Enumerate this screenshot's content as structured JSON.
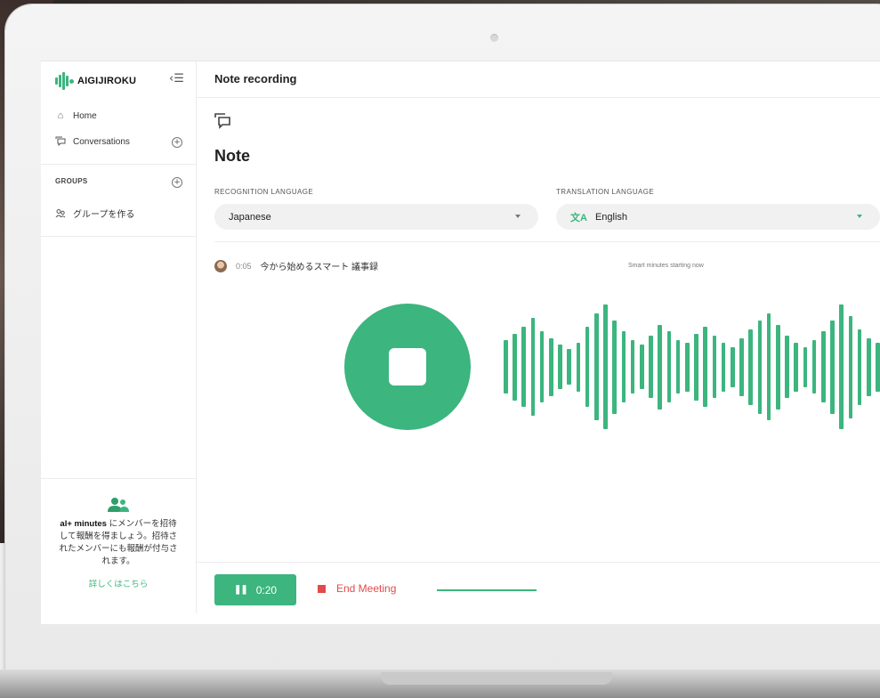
{
  "app": {
    "brand": "AIGIJIROKU",
    "accent_color": "#3cb57e",
    "danger_color": "#e24b4b"
  },
  "sidebar": {
    "collapse_icon": "collapse-menu-icon",
    "items": [
      {
        "label": "Home",
        "icon": "home-icon"
      },
      {
        "label": "Conversations",
        "icon": "chat-icon"
      }
    ],
    "groups_label": "GROUPS",
    "group_item": {
      "label": "グループを作る",
      "icon": "people-icon"
    },
    "promo": {
      "icon": "users-icon",
      "bold": "al+ minutes",
      "text": " にメンバーを招待して報酬を得ましょう。招待されたメンバーにも報酬が付与されます。",
      "link": "詳しくはこちら"
    }
  },
  "header": {
    "title": "Note recording"
  },
  "note": {
    "icon": "note-chat-icon",
    "title": "Note",
    "recognition": {
      "label": "RECOGNITION LANGUAGE",
      "value": "Japanese"
    },
    "translation": {
      "label": "TRANSLATION LANGUAGE",
      "value": "English",
      "icon": "translate-icon"
    }
  },
  "transcript": [
    {
      "time": "0:05",
      "text": "今から始めるスマート 議事録",
      "translation": "Smart minutes starting now"
    }
  ],
  "recorder": {
    "stop_icon": "stop-icon"
  },
  "controls": {
    "timer": "0:20",
    "pause_icon": "pause-icon",
    "end_label": "End Meeting"
  }
}
